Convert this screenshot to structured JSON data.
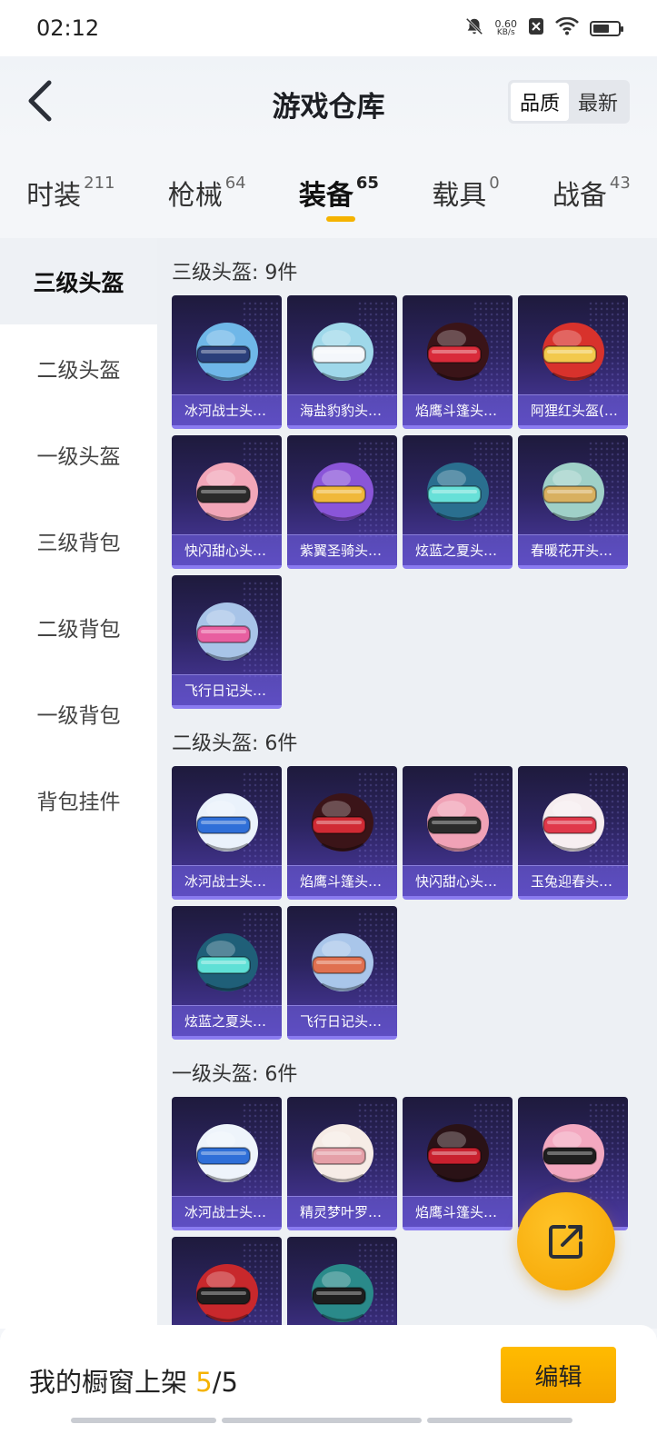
{
  "status_bar": {
    "time": "02:12",
    "net_speed": "0.60",
    "net_unit": "KB/s",
    "icons": [
      "mute-bell-icon",
      "x-app-icon",
      "wifi-icon",
      "battery-icon"
    ]
  },
  "header": {
    "title": "游戏仓库",
    "sort_options": [
      "品质",
      "最新"
    ],
    "sort_selected": "品质"
  },
  "categories": [
    {
      "name": "时装",
      "count": "211"
    },
    {
      "name": "枪械",
      "count": "64"
    },
    {
      "name": "装备",
      "count": "65",
      "active": true
    },
    {
      "name": "载具",
      "count": "0"
    },
    {
      "name": "战备",
      "count": "43"
    }
  ],
  "sidebar": {
    "items": [
      {
        "label": "三级头盔",
        "active": true
      },
      {
        "label": "二级头盔"
      },
      {
        "label": "一级头盔"
      },
      {
        "label": "三级背包"
      },
      {
        "label": "二级背包"
      },
      {
        "label": "一级背包"
      },
      {
        "label": "背包挂件"
      }
    ]
  },
  "sections": [
    {
      "title": "三级头盔: 9件",
      "items": [
        {
          "name": "冰河战士头…",
          "color": "#6fb7e8",
          "accent": "#2b3f7a"
        },
        {
          "name": "海盐豹豹头…",
          "color": "#9fd8ea",
          "accent": "#f4f7fb"
        },
        {
          "name": "焰鹰斗篷头…",
          "color": "#3a1418",
          "accent": "#d92b3a"
        },
        {
          "name": "阿狸红头盔(…",
          "color": "#d8322c",
          "accent": "#f2c94c"
        },
        {
          "name": "快闪甜心头…",
          "color": "#f2a6b8",
          "accent": "#2a2a2a"
        },
        {
          "name": "紫翼圣骑头…",
          "color": "#8a55d8",
          "accent": "#f0b83a"
        },
        {
          "name": "炫蓝之夏头…",
          "color": "#2a6f8f",
          "accent": "#67e0d8"
        },
        {
          "name": "春暖花开头…",
          "color": "#9fd0c8",
          "accent": "#d8b060"
        },
        {
          "name": "飞行日记头…",
          "color": "#a8c4e8",
          "accent": "#e85fa0"
        }
      ]
    },
    {
      "title": "二级头盔: 6件",
      "items": [
        {
          "name": "冰河战士头…",
          "color": "#eaf2fb",
          "accent": "#2f6fd8"
        },
        {
          "name": "焰鹰斗篷头…",
          "color": "#3b1418",
          "accent": "#d02a34"
        },
        {
          "name": "快闪甜心头…",
          "color": "#f0a2b6",
          "accent": "#2a2a2a"
        },
        {
          "name": "玉兔迎春头…",
          "color": "#f6eef0",
          "accent": "#e0384a"
        },
        {
          "name": "炫蓝之夏头…",
          "color": "#1f5f78",
          "accent": "#5fe0d6"
        },
        {
          "name": "飞行日记头…",
          "color": "#a9c6ea",
          "accent": "#e07050"
        }
      ]
    },
    {
      "title": "一级头盔: 6件",
      "items": [
        {
          "name": "冰河战士头…",
          "color": "#eef4fb",
          "accent": "#2f6fd8"
        },
        {
          "name": "精灵梦叶罗…",
          "color": "#f6ece6",
          "accent": "#e5a0a8"
        },
        {
          "name": "焰鹰斗篷头…",
          "color": "#2a1216",
          "accent": "#c8202e"
        },
        {
          "name": "",
          "color": "#f3a8c0",
          "accent": "#1e1e1e"
        },
        {
          "name": "",
          "color": "#c8282c",
          "accent": "#1e1e1e"
        },
        {
          "name": "",
          "color": "#2a8a8a",
          "accent": "#1e1e1e"
        }
      ]
    }
  ],
  "bottom_bar": {
    "shelf_label": "我的橱窗上架",
    "shelf_current": "5",
    "shelf_total": "/5",
    "edit_label": "编辑"
  },
  "colors": {
    "accent": "#f5b300",
    "card_bg": "#2c2460",
    "card_border": "#8a7bf0"
  }
}
